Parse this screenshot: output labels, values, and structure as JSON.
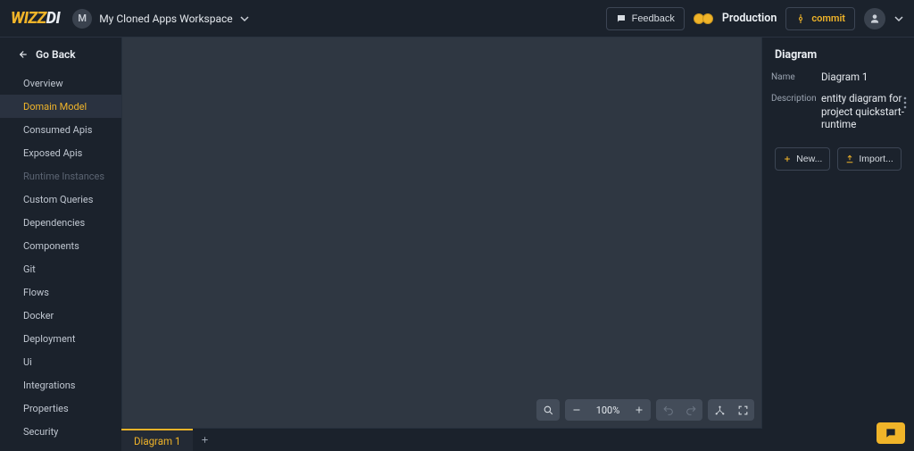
{
  "header": {
    "logo_part1": "WIZZ",
    "logo_part2": "DI",
    "workspace_initial": "M",
    "workspace_name": "My Cloned Apps Workspace",
    "feedback_label": "Feedback",
    "production_label": "Production",
    "commit_label": "commit"
  },
  "sidebar": {
    "back_label": "Go Back",
    "items": [
      {
        "label": "Overview",
        "active": false
      },
      {
        "label": "Domain Model",
        "active": true
      },
      {
        "label": "Consumed Apis",
        "active": false
      },
      {
        "label": "Exposed Apis",
        "active": false
      },
      {
        "label": "Runtime Instances",
        "active": false,
        "disabled": true
      },
      {
        "label": "Custom Queries",
        "active": false
      },
      {
        "label": "Dependencies",
        "active": false
      },
      {
        "label": "Components",
        "active": false
      },
      {
        "label": "Git",
        "active": false
      },
      {
        "label": "Flows",
        "active": false
      },
      {
        "label": "Docker",
        "active": false
      },
      {
        "label": "Deployment",
        "active": false
      },
      {
        "label": "Ui",
        "active": false
      },
      {
        "label": "Integrations",
        "active": false
      },
      {
        "label": "Properties",
        "active": false
      },
      {
        "label": "Security",
        "active": false
      }
    ]
  },
  "canvas": {
    "zoom": "100%",
    "tabs": [
      {
        "label": "Diagram 1",
        "active": true
      }
    ]
  },
  "rightpanel": {
    "title": "Diagram",
    "name_label": "Name",
    "name_value": "Diagram 1",
    "desc_label": "Description",
    "desc_value": "entity diagram for project quickstart-runtime",
    "new_label": "New...",
    "import_label": "Import..."
  }
}
